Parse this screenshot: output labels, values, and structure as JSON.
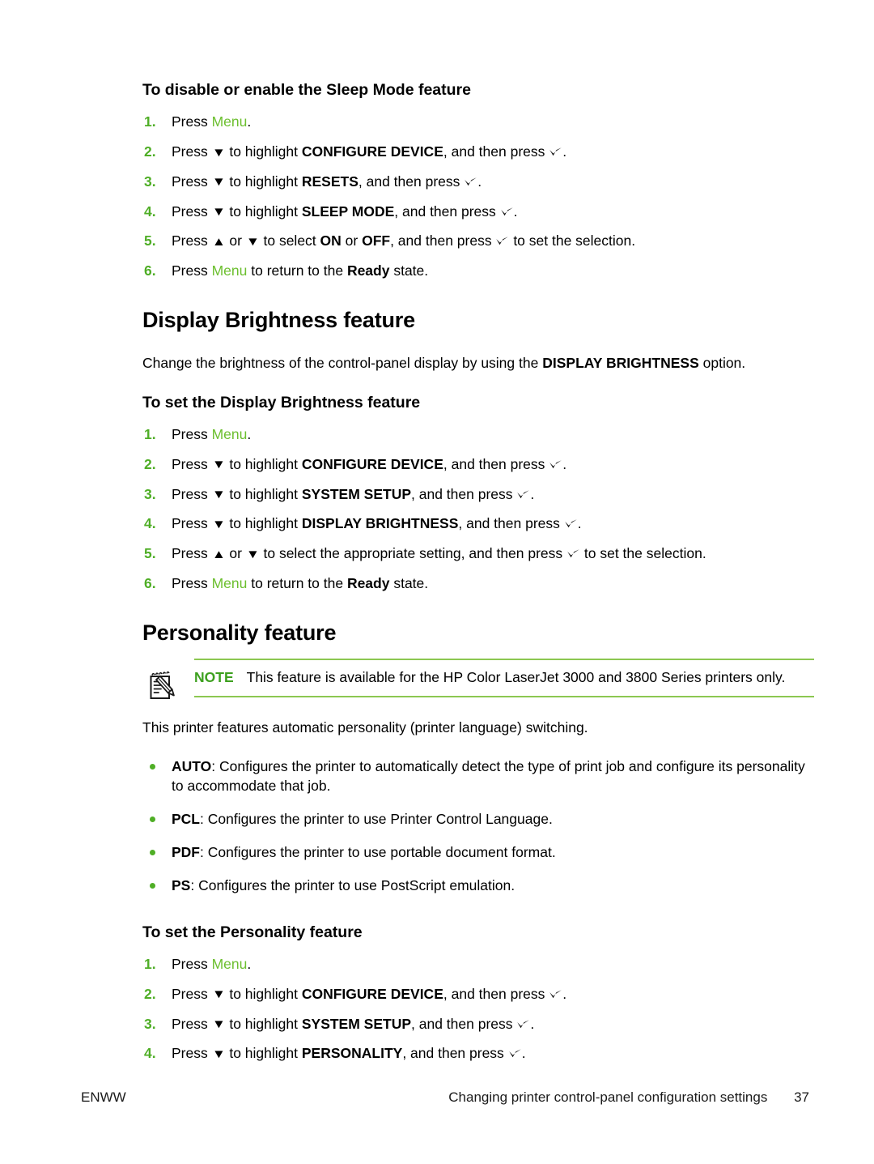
{
  "document": {
    "footer": {
      "left_label": "ENWW",
      "chapter_title": "Changing printer control-panel configuration settings",
      "page_number": "37"
    }
  },
  "colors": {
    "step_number_green": "#4fae26",
    "menu_token_green": "#6cbf2f",
    "note_label_green": "#3da01f",
    "note_rule_green": "#8cc751",
    "bullet_green": "#4fae26",
    "text_black": "#000000"
  },
  "glyphs": {
    "down_arrow": "▼",
    "up_arrow": "▲",
    "select_check": "✔"
  },
  "sections": {
    "sleep_mode": {
      "subheading": "To disable or enable the Sleep Mode feature",
      "steps": [
        {
          "num": "1.",
          "parts": [
            {
              "t": "text",
              "v": "Press "
            },
            {
              "t": "menu",
              "v": "Menu"
            },
            {
              "t": "text",
              "v": "."
            }
          ]
        },
        {
          "num": "2.",
          "parts": [
            {
              "t": "text",
              "v": "Press "
            },
            {
              "t": "glyph",
              "v": "down_arrow"
            },
            {
              "t": "text",
              "v": " to highlight "
            },
            {
              "t": "bold",
              "v": "CONFIGURE DEVICE"
            },
            {
              "t": "text",
              "v": ", and then press "
            },
            {
              "t": "check",
              "v": "select_check"
            },
            {
              "t": "text",
              "v": "."
            }
          ]
        },
        {
          "num": "3.",
          "parts": [
            {
              "t": "text",
              "v": "Press "
            },
            {
              "t": "glyph",
              "v": "down_arrow"
            },
            {
              "t": "text",
              "v": " to highlight "
            },
            {
              "t": "bold",
              "v": "RESETS"
            },
            {
              "t": "text",
              "v": ", and then press "
            },
            {
              "t": "check",
              "v": "select_check"
            },
            {
              "t": "text",
              "v": "."
            }
          ]
        },
        {
          "num": "4.",
          "parts": [
            {
              "t": "text",
              "v": "Press "
            },
            {
              "t": "glyph",
              "v": "down_arrow"
            },
            {
              "t": "text",
              "v": " to highlight "
            },
            {
              "t": "bold",
              "v": "SLEEP MODE"
            },
            {
              "t": "text",
              "v": ", and then press "
            },
            {
              "t": "check",
              "v": "select_check"
            },
            {
              "t": "text",
              "v": "."
            }
          ]
        },
        {
          "num": "5.",
          "parts": [
            {
              "t": "text",
              "v": "Press "
            },
            {
              "t": "glyph",
              "v": "up_arrow"
            },
            {
              "t": "text",
              "v": " or "
            },
            {
              "t": "glyph",
              "v": "down_arrow"
            },
            {
              "t": "text",
              "v": " to select "
            },
            {
              "t": "bold",
              "v": "ON"
            },
            {
              "t": "text",
              "v": " or "
            },
            {
              "t": "bold",
              "v": "OFF"
            },
            {
              "t": "text",
              "v": ", and then press "
            },
            {
              "t": "check",
              "v": "select_check"
            },
            {
              "t": "text",
              "v": " to set the selection."
            }
          ]
        },
        {
          "num": "6.",
          "parts": [
            {
              "t": "text",
              "v": "Press "
            },
            {
              "t": "menu",
              "v": "Menu"
            },
            {
              "t": "text",
              "v": " to return to the "
            },
            {
              "t": "bold",
              "v": "Ready"
            },
            {
              "t": "text",
              "v": " state."
            }
          ]
        }
      ]
    },
    "display_brightness": {
      "heading": "Display Brightness feature",
      "intro": [
        {
          "t": "text",
          "v": "Change the brightness of the control-panel display by using the "
        },
        {
          "t": "bold",
          "v": "DISPLAY BRIGHTNESS"
        },
        {
          "t": "text",
          "v": " option."
        }
      ],
      "subheading": "To set the Display Brightness feature",
      "steps": [
        {
          "num": "1.",
          "parts": [
            {
              "t": "text",
              "v": "Press "
            },
            {
              "t": "menu",
              "v": "Menu"
            },
            {
              "t": "text",
              "v": "."
            }
          ]
        },
        {
          "num": "2.",
          "parts": [
            {
              "t": "text",
              "v": "Press "
            },
            {
              "t": "glyph",
              "v": "down_arrow"
            },
            {
              "t": "text",
              "v": " to highlight "
            },
            {
              "t": "bold",
              "v": "CONFIGURE DEVICE"
            },
            {
              "t": "text",
              "v": ", and then press "
            },
            {
              "t": "check",
              "v": "select_check"
            },
            {
              "t": "text",
              "v": "."
            }
          ]
        },
        {
          "num": "3.",
          "parts": [
            {
              "t": "text",
              "v": "Press "
            },
            {
              "t": "glyph",
              "v": "down_arrow"
            },
            {
              "t": "text",
              "v": " to highlight "
            },
            {
              "t": "bold",
              "v": "SYSTEM SETUP"
            },
            {
              "t": "text",
              "v": ", and then press "
            },
            {
              "t": "check",
              "v": "select_check"
            },
            {
              "t": "text",
              "v": "."
            }
          ]
        },
        {
          "num": "4.",
          "parts": [
            {
              "t": "text",
              "v": "Press "
            },
            {
              "t": "glyph",
              "v": "down_arrow"
            },
            {
              "t": "text",
              "v": " to highlight "
            },
            {
              "t": "bold",
              "v": "DISPLAY BRIGHTNESS"
            },
            {
              "t": "text",
              "v": ", and then press "
            },
            {
              "t": "check",
              "v": "select_check"
            },
            {
              "t": "text",
              "v": "."
            }
          ]
        },
        {
          "num": "5.",
          "parts": [
            {
              "t": "text",
              "v": "Press "
            },
            {
              "t": "glyph",
              "v": "up_arrow"
            },
            {
              "t": "text",
              "v": " or "
            },
            {
              "t": "glyph",
              "v": "down_arrow"
            },
            {
              "t": "text",
              "v": " to select the appropriate setting, and then press "
            },
            {
              "t": "check",
              "v": "select_check"
            },
            {
              "t": "text",
              "v": " to set the selection."
            }
          ]
        },
        {
          "num": "6.",
          "parts": [
            {
              "t": "text",
              "v": "Press "
            },
            {
              "t": "menu",
              "v": "Menu"
            },
            {
              "t": "text",
              "v": " to return to the "
            },
            {
              "t": "bold",
              "v": "Ready"
            },
            {
              "t": "text",
              "v": " state."
            }
          ]
        }
      ]
    },
    "personality": {
      "heading": "Personality feature",
      "note": {
        "icon_name": "note-pad-pencil-icon",
        "label": "NOTE",
        "text": "This feature is available for the HP Color LaserJet 3000 and 3800 Series printers only."
      },
      "intro": "This printer features automatic personality (printer language) switching.",
      "bullets": [
        [
          {
            "t": "bold",
            "v": "AUTO"
          },
          {
            "t": "text",
            "v": ": Configures the printer to automatically detect the type of print job and configure its personality to accommodate that job."
          }
        ],
        [
          {
            "t": "bold",
            "v": "PCL"
          },
          {
            "t": "text",
            "v": ": Configures the printer to use Printer Control Language."
          }
        ],
        [
          {
            "t": "bold",
            "v": "PDF"
          },
          {
            "t": "text",
            "v": ": Configures the printer to use portable document format."
          }
        ],
        [
          {
            "t": "bold",
            "v": "PS"
          },
          {
            "t": "text",
            "v": ": Configures the printer to use PostScript emulation."
          }
        ]
      ],
      "subheading": "To set the Personality feature",
      "steps": [
        {
          "num": "1.",
          "parts": [
            {
              "t": "text",
              "v": "Press "
            },
            {
              "t": "menu",
              "v": "Menu"
            },
            {
              "t": "text",
              "v": "."
            }
          ]
        },
        {
          "num": "2.",
          "parts": [
            {
              "t": "text",
              "v": "Press "
            },
            {
              "t": "glyph",
              "v": "down_arrow"
            },
            {
              "t": "text",
              "v": " to highlight "
            },
            {
              "t": "bold",
              "v": "CONFIGURE DEVICE"
            },
            {
              "t": "text",
              "v": ", and then press "
            },
            {
              "t": "check",
              "v": "select_check"
            },
            {
              "t": "text",
              "v": "."
            }
          ]
        },
        {
          "num": "3.",
          "parts": [
            {
              "t": "text",
              "v": "Press "
            },
            {
              "t": "glyph",
              "v": "down_arrow"
            },
            {
              "t": "text",
              "v": " to highlight "
            },
            {
              "t": "bold",
              "v": "SYSTEM SETUP"
            },
            {
              "t": "text",
              "v": ", and then press "
            },
            {
              "t": "check",
              "v": "select_check"
            },
            {
              "t": "text",
              "v": "."
            }
          ]
        },
        {
          "num": "4.",
          "parts": [
            {
              "t": "text",
              "v": "Press "
            },
            {
              "t": "glyph",
              "v": "down_arrow"
            },
            {
              "t": "text",
              "v": " to highlight "
            },
            {
              "t": "bold",
              "v": "PERSONALITY"
            },
            {
              "t": "text",
              "v": ", and then press "
            },
            {
              "t": "check",
              "v": "select_check"
            },
            {
              "t": "text",
              "v": "."
            }
          ]
        }
      ]
    }
  }
}
